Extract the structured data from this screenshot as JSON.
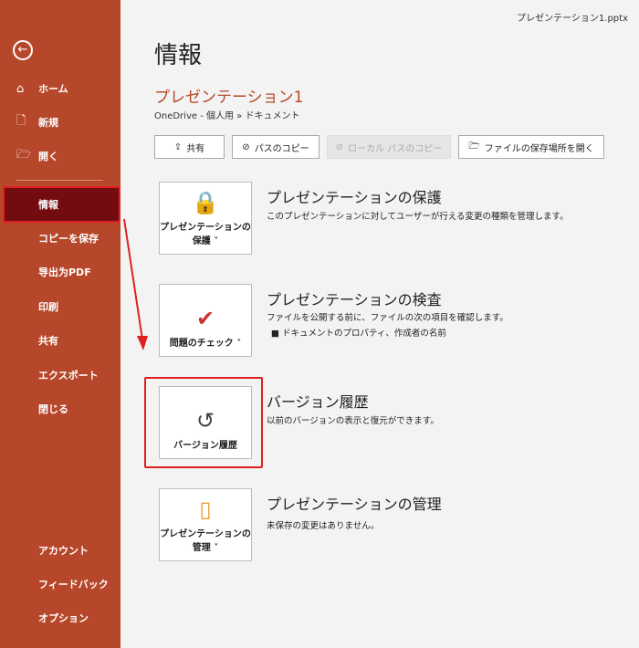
{
  "window": {
    "filename": "プレゼンテーション1.pptx"
  },
  "sidebar": {
    "back": "←",
    "top": [
      {
        "icon": "⌂",
        "label": "ホーム"
      },
      {
        "icon": "🗋",
        "label": "新規"
      },
      {
        "icon": "🗁",
        "label": "開く"
      }
    ],
    "items": [
      "情報",
      "コピーを保存",
      "导出为PDF",
      "印刷",
      "共有",
      "エクスポート",
      "閉じる"
    ],
    "bottom": [
      "アカウント",
      "フィードバック",
      "オプション"
    ]
  },
  "main": {
    "title": "情報",
    "doc_name": "プレゼンテーション1",
    "path": "OneDrive - 個人用 » ドキュメント",
    "buttons": [
      {
        "icon": "⇪",
        "label": "共有"
      },
      {
        "icon": "⊘",
        "label": "パスのコピー"
      },
      {
        "icon": "⊘",
        "label": "ローカル パスのコピー"
      },
      {
        "icon": "🗁",
        "label": "ファイルの保存場所を開く"
      }
    ],
    "sections": [
      {
        "card": "プレゼンテーションの保護 ˅",
        "icon": "🔒",
        "title": "プレゼンテーションの保護",
        "desc": "このプレゼンテーションに対してユーザーが行える変更の種類を管理します。"
      },
      {
        "card": "問題のチェック ˅",
        "icon": "✔",
        "title": "プレゼンテーションの検査",
        "desc": "ファイルを公開する前に、ファイルの次の項目を確認します。",
        "bullet": "ドキュメントのプロパティ、作成者の名前"
      },
      {
        "card": "バージョン履歴",
        "icon": "↺",
        "title": "バージョン履歴",
        "desc": "以前のバージョンの表示と復元ができます。"
      },
      {
        "card": "プレゼンテーションの管理 ˅",
        "icon": "▯",
        "title": "プレゼンテーションの管理",
        "desc": "未保存の変更はありません。"
      }
    ]
  }
}
